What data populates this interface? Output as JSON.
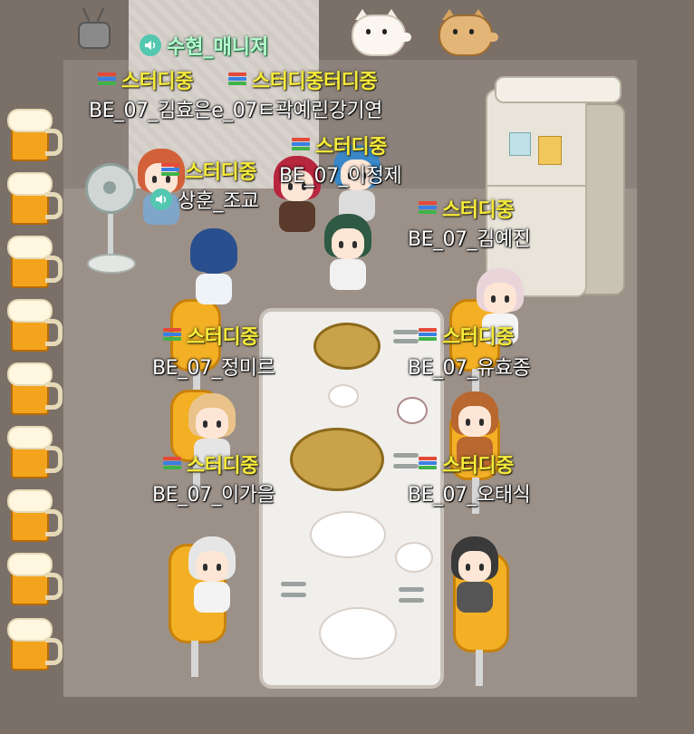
{
  "voice_labels": {
    "manager": "수현_매니저",
    "assistant": "상훈_조교"
  },
  "status_text": "스터디중",
  "status_duplicate_join": "스터디중터디중",
  "names": {
    "top_left_pair": "BE_07_김효은e_07ㅌ곽예린강기연",
    "center": "BE_07_이정제",
    "right_top": "BE_07_김예진",
    "left_mid": "BE_07_정미르",
    "right_mid": "BE_07_유효종",
    "left_low": "BE_07_이가을",
    "right_low": "BE_07_오태식"
  },
  "colors": {
    "status_text": "#f6ea3b",
    "voice_text": "#b8ffcf",
    "speaker_badge": "#54c7b0",
    "chair": "#f3b025",
    "room_floor": "#9c9189"
  },
  "icons": {
    "status": "book-stack-icon",
    "voice": "speaker-icon",
    "beer": "beer-mug-icon"
  }
}
